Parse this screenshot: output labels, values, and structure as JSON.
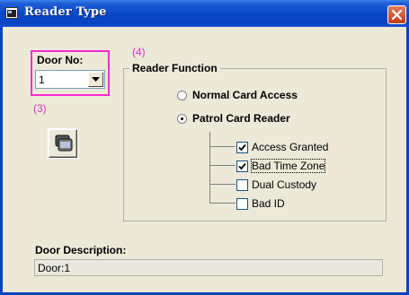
{
  "window": {
    "title": "Reader Type"
  },
  "annotations": {
    "a3": "(3)",
    "a4": "(4)"
  },
  "door": {
    "label": "Door No:",
    "value": "1"
  },
  "reader_function": {
    "title": "Reader Function",
    "radios": [
      {
        "label": "Normal Card Access",
        "checked": false
      },
      {
        "label": "Patrol Card Reader",
        "checked": true
      }
    ],
    "checkboxes": [
      {
        "label": "Access Granted",
        "checked": true
      },
      {
        "label": "Bad Time Zone",
        "checked": true
      },
      {
        "label": "Dual Custody",
        "checked": false
      },
      {
        "label": "Bad ID",
        "checked": false
      }
    ]
  },
  "description": {
    "label": "Door Description:",
    "value": "Door:1"
  },
  "colors": {
    "titlebar": "#0843c2",
    "annotation": "#e030c8",
    "highlight_box": "#ff2bd2",
    "dialog_bg": "#ece9d8"
  },
  "icons": [
    "window-app-icon",
    "close-icon",
    "dropdown-arrow-icon",
    "card-reader-icon",
    "checkmark-icon"
  ]
}
